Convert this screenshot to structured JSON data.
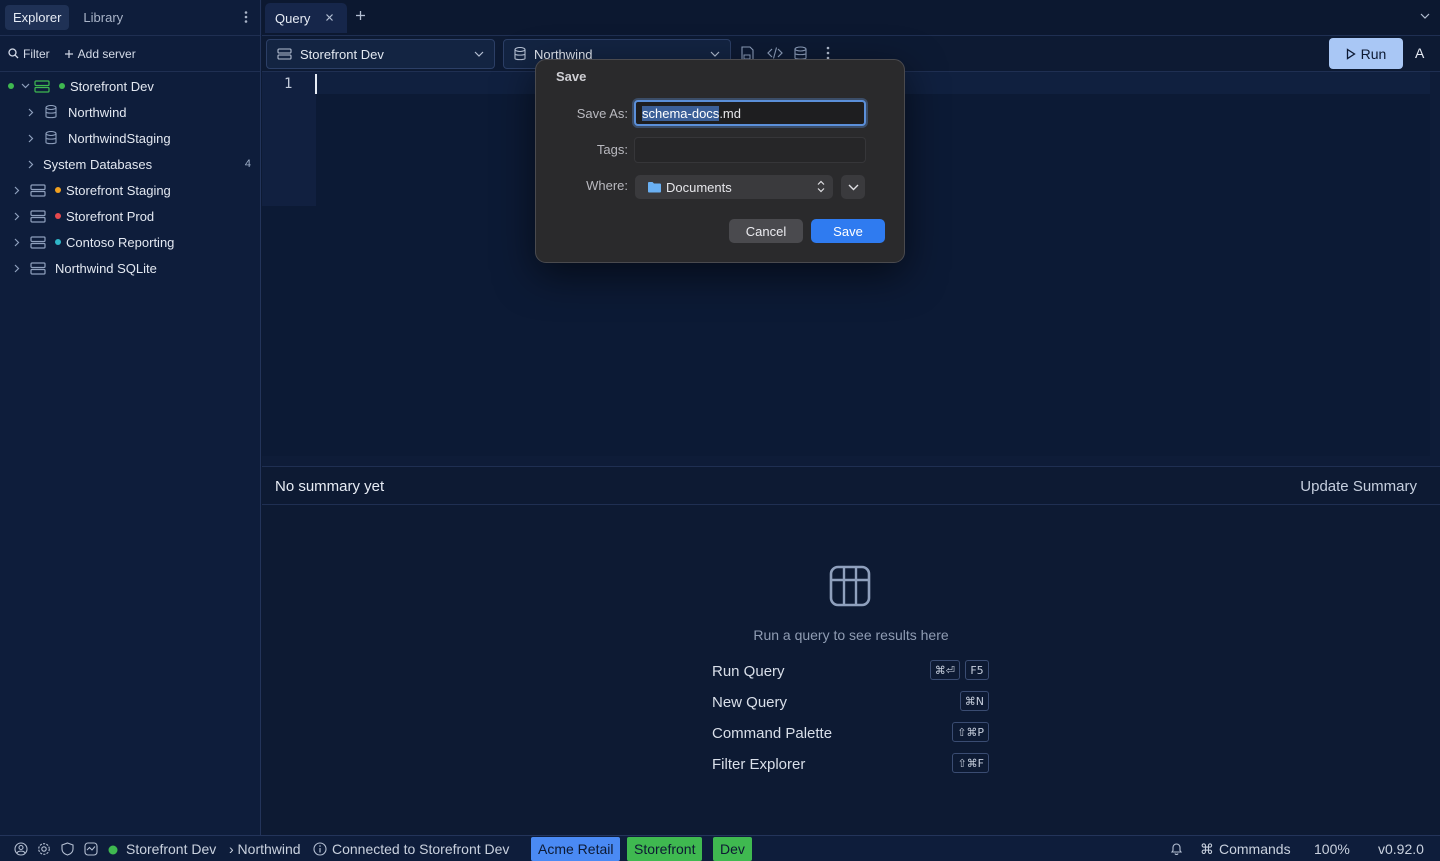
{
  "sidebar": {
    "tabs": [
      {
        "label": "Explorer",
        "active": true
      },
      {
        "label": "Library",
        "active": false
      }
    ],
    "toolbar": {
      "filter_label": "Filter",
      "add_server_label": "Add server"
    },
    "tree": [
      {
        "label": "Storefront Dev",
        "kind": "server",
        "status_color": "#3fb950",
        "expanded": true
      },
      {
        "label": "Northwind",
        "kind": "database"
      },
      {
        "label": "NorthwindStaging",
        "kind": "database"
      },
      {
        "label": "System Databases",
        "kind": "folder",
        "count": "4"
      },
      {
        "label": "Storefront Staging",
        "kind": "server",
        "status_color": "#f0a020"
      },
      {
        "label": "Storefront Prod",
        "kind": "server",
        "status_color": "#e5484d"
      },
      {
        "label": "Contoso Reporting",
        "kind": "server",
        "status_color": "#2fb6c8"
      },
      {
        "label": "Northwind SQLite",
        "kind": "server"
      }
    ]
  },
  "tabs": [
    {
      "label": "Query",
      "active": true
    }
  ],
  "toolbar": {
    "server_select": "Storefront Dev",
    "database_select": "Northwind",
    "run_label": "Run",
    "extra_label": "A"
  },
  "editor": {
    "line_number": "1"
  },
  "summary": {
    "title": "No summary yet",
    "update_label": "Update Summary"
  },
  "results": {
    "empty_text": "Run a query to see results here",
    "shortcuts": [
      {
        "label": "Run Query",
        "keys": [
          "⌘⏎",
          "F5"
        ]
      },
      {
        "label": "New Query",
        "keys": [
          "⌘N"
        ]
      },
      {
        "label": "Command Palette",
        "keys": [
          "⇧⌘P"
        ]
      },
      {
        "label": "Filter Explorer",
        "keys": [
          "⇧⌘F"
        ]
      }
    ]
  },
  "statusbar": {
    "server": "Storefront Dev",
    "database": "› Northwind",
    "connection": "Connected to Storefront Dev",
    "badges": [
      {
        "label": "Acme Retail",
        "color": "#4a8af4"
      },
      {
        "label": "Storefront",
        "color": "#3fb950"
      },
      {
        "label": "Dev",
        "color": "#3fb950"
      }
    ],
    "commands_label": "Commands",
    "zoom": "100%",
    "version": "v0.92.0"
  },
  "dialog": {
    "title": "Save",
    "save_as_label": "Save As:",
    "filename_selected": "schema-docs",
    "filename_ext": ".md",
    "tags_label": "Tags:",
    "tags_value": "",
    "where_label": "Where:",
    "where_value": "Documents",
    "cancel_label": "Cancel",
    "save_label": "Save"
  }
}
